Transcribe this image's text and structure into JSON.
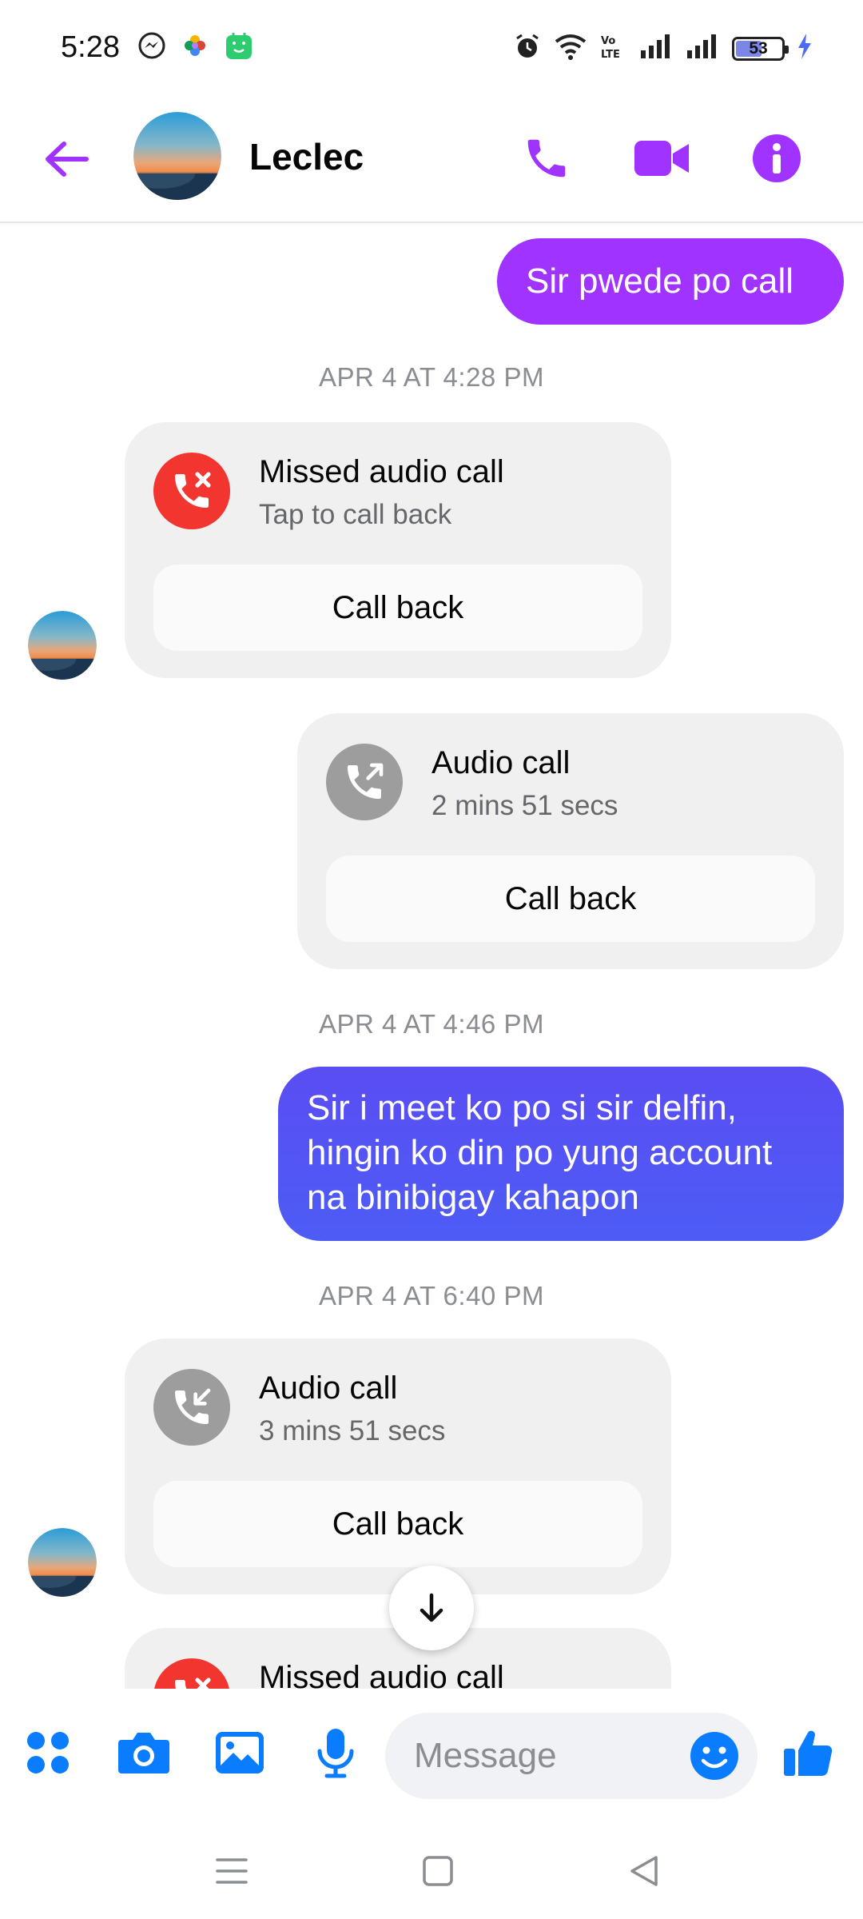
{
  "status_bar": {
    "time": "5:28",
    "battery": "53",
    "icons": [
      "messenger-icon",
      "photos-icon",
      "store-icon",
      "alarm-icon",
      "wifi-icon",
      "volte-icon",
      "signal-icon",
      "signal-icon",
      "battery-icon",
      "charging-icon"
    ]
  },
  "header": {
    "contact_name": "Leclec",
    "icons": [
      "back-arrow-icon",
      "phone-icon",
      "video-icon",
      "info-icon"
    ]
  },
  "messages": {
    "outgoing_1": "Sir pwede po call",
    "timestamp_1": "APR 4 AT 4:28 PM",
    "missed_call_1": {
      "title": "Missed audio call",
      "subtitle": "Tap to call back",
      "button": "Call back"
    },
    "audio_call_1": {
      "title": "Audio call",
      "subtitle": "2 mins 51 secs",
      "button": "Call back"
    },
    "timestamp_2": "APR 4 AT 4:46 PM",
    "outgoing_2": "Sir i meet ko po si sir delfin, hingin ko din po yung account na binibigay kahapon",
    "timestamp_3": "APR 4 AT 6:40 PM",
    "audio_call_2": {
      "title": "Audio call",
      "subtitle": "3 mins 51 secs",
      "button": "Call back"
    },
    "missed_call_2": {
      "title": "Missed audio call"
    }
  },
  "composer": {
    "placeholder": "Message",
    "icons": [
      "menu-dots-icon",
      "camera-icon",
      "gallery-icon",
      "microphone-icon",
      "emoji-icon",
      "like-icon"
    ]
  },
  "colors": {
    "accent_purple": "#a033ff",
    "outgoing_blue": "#4d5cf5",
    "missed_red": "#f3352f",
    "messenger_blue": "#0a7cff"
  }
}
